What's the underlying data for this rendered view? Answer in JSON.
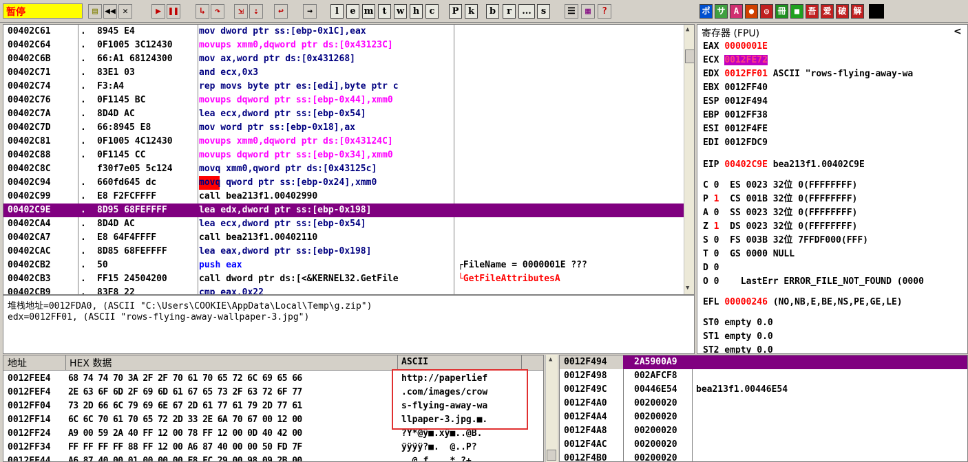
{
  "toolbar": {
    "status": "暂停",
    "letters": [
      "l",
      "e",
      "m",
      "t",
      "w",
      "h",
      "c",
      "P",
      "k",
      "b",
      "r",
      "...",
      "s"
    ],
    "plugins": [
      "ポ",
      "サ",
      "A",
      "●",
      "◎",
      "冊",
      "■",
      "吾",
      "爱",
      "破",
      "解"
    ]
  },
  "cpu": {
    "rows": [
      {
        "addr": "00402C61",
        "dot": ".",
        "hex": "8945 E4",
        "asm": "mov dword ptr ss:[ebp-0x1C],eax",
        "comment": ""
      },
      {
        "addr": "00402C64",
        "dot": ".",
        "hex": "0F1005 3C12430",
        "asm": "movups xmm0,dqword ptr ds:[0x43123C]",
        "comment": ""
      },
      {
        "addr": "00402C6B",
        "dot": ".",
        "hex": "66:A1 68124300",
        "asm": "mov ax,word ptr ds:[0x431268]",
        "comment": ""
      },
      {
        "addr": "00402C71",
        "dot": ".",
        "hex": "83E1 03",
        "asm": "and ecx,0x3",
        "comment": ""
      },
      {
        "addr": "00402C74",
        "dot": ".",
        "hex": "F3:A4",
        "asm": "rep movs byte ptr es:[edi],byte ptr c",
        "comment": ""
      },
      {
        "addr": "00402C76",
        "dot": ".",
        "hex": "0F1145 BC",
        "asm": "movups dqword ptr ss:[ebp-0x44],xmm0",
        "comment": ""
      },
      {
        "addr": "00402C7A",
        "dot": ".",
        "hex": "8D4D AC",
        "asm": "lea ecx,dword ptr ss:[ebp-0x54]",
        "comment": ""
      },
      {
        "addr": "00402C7D",
        "dot": ".",
        "hex": "66:8945 E8",
        "asm": "mov word ptr ss:[ebp-0x18],ax",
        "comment": ""
      },
      {
        "addr": "00402C81",
        "dot": ".",
        "hex": "0F1005 4C12430",
        "asm": "movups xmm0,dqword ptr ds:[0x43124C]",
        "comment": ""
      },
      {
        "addr": "00402C88",
        "dot": ".",
        "hex": "0F1145 CC",
        "asm": "movups dqword ptr ss:[ebp-0x34],xmm0",
        "comment": ""
      },
      {
        "addr": "00402C8C",
        "dot": "",
        "hex": "f30f7e05 5c124",
        "asm": "movq xmm0,qword ptr ds:[0x43125c]",
        "comment": ""
      },
      {
        "addr": "00402C94",
        "dot": ".",
        "hex": "660fd645 dc",
        "asm": "movq qword ptr ss:[ebp-0x24],xmm0",
        "comment": ""
      },
      {
        "addr": "00402C99",
        "dot": ".",
        "hex": "E8 F2FCFFFF",
        "asm": "call bea213f1.00402990",
        "comment": ""
      },
      {
        "addr": "00402C9E",
        "dot": ".",
        "hex": "8D95 68FEFFFF",
        "asm": "lea edx,dword ptr ss:[ebp-0x198]",
        "comment": ""
      },
      {
        "addr": "00402CA4",
        "dot": ".",
        "hex": "8D4D AC",
        "asm": "lea ecx,dword ptr ss:[ebp-0x54]",
        "comment": ""
      },
      {
        "addr": "00402CA7",
        "dot": ".",
        "hex": "E8 64F4FFFF",
        "asm": "call bea213f1.00402110",
        "comment": ""
      },
      {
        "addr": "00402CAC",
        "dot": ".",
        "hex": "8D85 68FEFFFF",
        "asm": "lea eax,dword ptr ss:[ebp-0x198]",
        "comment": ""
      },
      {
        "addr": "00402CB2",
        "dot": ".",
        "hex": "50",
        "asm": "push eax",
        "comment": "┌FileName = 0000001E ???"
      },
      {
        "addr": "00402CB3",
        "dot": ".",
        "hex": "FF15 24504200",
        "asm": "call dword ptr ds:[<&KERNEL32.GetFile",
        "comment": "└GetFileAttributesA"
      },
      {
        "addr": "00402CB9",
        "dot": ".",
        "hex": "83F8 22",
        "asm": "cmp eax,0x22",
        "comment": ""
      }
    ]
  },
  "info": {
    "line1": "堆栈地址=0012FDA0, (ASCII \"C:\\Users\\COOKIE\\AppData\\Local\\Temp\\g.zip\")",
    "line2": "edx=0012FF01, (ASCII \"rows-flying-away-wallpaper-3.jpg\")"
  },
  "regs": {
    "title": "寄存器 (FPU)",
    "collapse": "<",
    "gp": [
      {
        "name": "EAX",
        "val": "0000001E",
        "extra": ""
      },
      {
        "name": "ECX",
        "val": "0012FE72",
        "extra": ""
      },
      {
        "name": "EDX",
        "val": "0012FF01",
        "extra": "ASCII \"rows-flying-away-wa"
      },
      {
        "name": "EBX",
        "val": "0012FF40",
        "extra": ""
      },
      {
        "name": "ESP",
        "val": "0012F494",
        "extra": ""
      },
      {
        "name": "EBP",
        "val": "0012FF38",
        "extra": ""
      },
      {
        "name": "ESI",
        "val": "0012F4FE",
        "extra": ""
      },
      {
        "name": "EDI",
        "val": "0012FDC9",
        "extra": ""
      }
    ],
    "eip": {
      "name": "EIP",
      "val": "00402C9E",
      "extra": "bea213f1.00402C9E"
    },
    "flags": [
      {
        "f": "C",
        "v": "0",
        "seg": "ES",
        "sel": "0023",
        "bits": "32位",
        "base": "0(FFFFFFFF)"
      },
      {
        "f": "P",
        "v": "1",
        "seg": "CS",
        "sel": "001B",
        "bits": "32位",
        "base": "0(FFFFFFFF)"
      },
      {
        "f": "A",
        "v": "0",
        "seg": "SS",
        "sel": "0023",
        "bits": "32位",
        "base": "0(FFFFFFFF)"
      },
      {
        "f": "Z",
        "v": "1",
        "seg": "DS",
        "sel": "0023",
        "bits": "32位",
        "base": "0(FFFFFFFF)"
      },
      {
        "f": "S",
        "v": "0",
        "seg": "FS",
        "sel": "003B",
        "bits": "32位",
        "base": "7FFDF000(FFF)"
      },
      {
        "f": "T",
        "v": "0",
        "seg": "GS",
        "sel": "0000",
        "bits": "NULL",
        "base": ""
      },
      {
        "f": "D",
        "v": "0",
        "seg": "",
        "sel": "",
        "bits": "",
        "base": ""
      },
      {
        "f": "O",
        "v": "0",
        "seg": "",
        "sel": "",
        "bits": "LastErr",
        "base": "ERROR_FILE_NOT_FOUND (0000"
      }
    ],
    "efl": {
      "name": "EFL",
      "val": "00000246",
      "extra": "(NO,NB,E,BE,NS,PE,GE,LE)"
    },
    "fpu": [
      "ST0 empty 0.0",
      "ST1 empty 0.0",
      "ST2 empty 0.0"
    ]
  },
  "dump": {
    "h_addr": "地址",
    "h_hex": "HEX 数据",
    "h_ascii": "ASCII",
    "rows": [
      {
        "addr": "0012FEE4",
        "hex": "68 74 74 70 3A 2F 2F 70 61 70 65 72 6C 69 65 66",
        "ascii": "http://paperlief"
      },
      {
        "addr": "0012FEF4",
        "hex": "2E 63 6F 6D 2F 69 6D 61 67 65 73 2F 63 72 6F 77",
        "ascii": ".com/images/crow"
      },
      {
        "addr": "0012FF04",
        "hex": "73 2D 66 6C 79 69 6E 67 2D 61 77 61 79 2D 77 61",
        "ascii": "s-flying-away-wa"
      },
      {
        "addr": "0012FF14",
        "hex": "6C 6C 70 61 70 65 72 2D 33 2E 6A 70 67 00 12 00",
        "ascii": "llpaper-3.jpg.■."
      },
      {
        "addr": "0012FF24",
        "hex": "A9 00 59 2A 40 FF 12 00 78 FF 12 00 0D 40 42 00",
        "ascii": "?Y*@ÿ■.xÿ■..@B."
      },
      {
        "addr": "0012FF34",
        "hex": "FF FF FF FF 88 FF 12 00 A6 87 40 00 00 50 FD 7F",
        "ascii": "ÿÿÿÿ?■.  @..P?"
      },
      {
        "addr": "0012FF44",
        "hex": "A6 87 40 00 01 00 00 00 F8 FC 29 00 98 09 2B 00",
        "ascii": "  @.ƒ    * ?+"
      }
    ]
  },
  "stack": {
    "rows": [
      {
        "addr": "0012F494",
        "val": "2A5900A9",
        "comment": ""
      },
      {
        "addr": "0012F498",
        "val": "002AFCF8",
        "comment": ""
      },
      {
        "addr": "0012F49C",
        "val": "00446E54",
        "comment": "bea213f1.00446E54"
      },
      {
        "addr": "0012F4A0",
        "val": "00200020",
        "comment": ""
      },
      {
        "addr": "0012F4A4",
        "val": "00200020",
        "comment": ""
      },
      {
        "addr": "0012F4A8",
        "val": "00200020",
        "comment": ""
      },
      {
        "addr": "0012F4AC",
        "val": "00200020",
        "comment": ""
      },
      {
        "addr": "0012F4B0",
        "val": "00200020",
        "comment": ""
      }
    ]
  }
}
